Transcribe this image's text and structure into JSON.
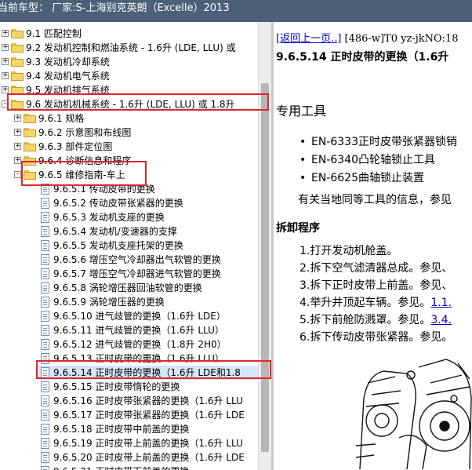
{
  "titlebar": {
    "text": "当前车型：  厂家:S-上海别克英朗（Excelle）2013"
  },
  "tree": {
    "rows": [
      {
        "label": "9.1 匹配控制",
        "indent": 0,
        "kind": "folder",
        "expander": "+"
      },
      {
        "label": "9.2 发动机控制和燃油系统 - 1.6升 (LDE, LLU) 或",
        "indent": 0,
        "kind": "folder",
        "expander": "+"
      },
      {
        "label": "9.3 发动机冷却系统",
        "indent": 0,
        "kind": "folder",
        "expander": "+"
      },
      {
        "label": "9.4 发动机电气系统",
        "indent": 0,
        "kind": "folder",
        "expander": "+"
      },
      {
        "label": "9.5 发动机排气系统",
        "indent": 0,
        "kind": "folder",
        "expander": "+"
      },
      {
        "label": "9.6 发动机机械系统 - 1.6升 (LDE, LLU) 或 1.8升",
        "indent": 0,
        "kind": "folder",
        "expander": "-"
      },
      {
        "label": "9.6.1 规格",
        "indent": 1,
        "kind": "folder",
        "expander": "+"
      },
      {
        "label": "9.6.2 示意图和布线图",
        "indent": 1,
        "kind": "folder",
        "expander": "+"
      },
      {
        "label": "9.6.3 部件定位图",
        "indent": 1,
        "kind": "folder",
        "expander": "+"
      },
      {
        "label": "9.6.4 诊断信息和程序",
        "indent": 1,
        "kind": "folder",
        "expander": "+"
      },
      {
        "label": "9.6.5 维修指南-车上",
        "indent": 1,
        "kind": "folder",
        "expander": "-"
      },
      {
        "label": "9.6.5.1 传动皮带的更换",
        "indent": 2,
        "kind": "doc"
      },
      {
        "label": "9.6.5.2 传动皮带张紧器的更换",
        "indent": 2,
        "kind": "doc"
      },
      {
        "label": "9.6.5.3 发动机支座的更换",
        "indent": 2,
        "kind": "doc"
      },
      {
        "label": "9.6.5.4 发动机/变速器的支撑",
        "indent": 2,
        "kind": "doc"
      },
      {
        "label": "9.6.5.5 发动机支座托架的更换",
        "indent": 2,
        "kind": "doc"
      },
      {
        "label": "9.6.5.6 增压空气冷却器出气软管的更换",
        "indent": 2,
        "kind": "doc"
      },
      {
        "label": "9.6.5.7 增压空气冷却器进气软管的更换",
        "indent": 2,
        "kind": "doc"
      },
      {
        "label": "9.6.5.8 涡轮增压器回油软管的更换",
        "indent": 2,
        "kind": "doc"
      },
      {
        "label": "9.6.5.9 涡轮增压器的更换",
        "indent": 2,
        "kind": "doc"
      },
      {
        "label": "9.6.5.10 进气歧管的更换（1.6升 LDE）",
        "indent": 2,
        "kind": "doc"
      },
      {
        "label": "9.6.5.11 进气歧管的更换（1.6升 LLU）",
        "indent": 2,
        "kind": "doc"
      },
      {
        "label": "9.6.5.12 进气歧管的更换（1.8升 2H0）",
        "indent": 2,
        "kind": "doc"
      },
      {
        "label": "9.6.5.13 正时皮带的更换（1.6升 LLU）",
        "indent": 2,
        "kind": "doc"
      },
      {
        "label": "9.6.5.14 正时皮带的更换（1.6升 LDE和1.8",
        "indent": 2,
        "kind": "doc",
        "selected": true
      },
      {
        "label": "9.6.5.15 正时皮带惰轮的更换",
        "indent": 2,
        "kind": "doc"
      },
      {
        "label": "9.6.5.16 正时皮带张紧器的更换（1.6升 LLU",
        "indent": 2,
        "kind": "doc"
      },
      {
        "label": "9.6.5.17 正时皮带张紧器的更换（1.6升 LDE",
        "indent": 2,
        "kind": "doc"
      },
      {
        "label": "9.6.5.18 正时皮带中前盖的更换",
        "indent": 2,
        "kind": "doc"
      },
      {
        "label": "9.6.5.19 正时皮带上前盖的更换（1.6升 LLU",
        "indent": 2,
        "kind": "doc"
      },
      {
        "label": "9.6.5.20 正时皮带上前盖的更换（1.6升 LDE",
        "indent": 2,
        "kind": "doc"
      },
      {
        "label": "9.6.5.21 正时皮带下前盖的更换",
        "indent": 2,
        "kind": "doc"
      }
    ]
  },
  "content": {
    "nav_link": "[返回上一页..]",
    "nav_rest": " [486-w]T0 yz-jkNO:18",
    "title": "9.6.5.14 正时皮带的更换（1.6升",
    "tools_heading": "专用工具",
    "tools": [
      "EN-6333正时皮带张紧器锁销",
      "EN-6340凸轮轴锁止工具",
      "EN-6625曲轴锁止装置"
    ],
    "tools_note": "有关当地同等工具的信息，参见",
    "removal_heading": "拆卸程序",
    "steps": [
      {
        "text": "1.打开发动机舱盖。",
        "link": ""
      },
      {
        "text": "2.拆下空气滤清器总成。参见、",
        "link": ""
      },
      {
        "text": "3.拆下正时皮带上前盖。参见、",
        "link": ""
      },
      {
        "text": "4.举升并顶起车辆。参见。",
        "link": "1.1."
      },
      {
        "text": "5.拆下前舱防溅罩。参见。",
        "link": "3.4."
      },
      {
        "text": "6.拆下传动皮带张紧器。参见。",
        "link": ""
      }
    ]
  },
  "colors": {
    "titlebar": "#4d5f79",
    "highlight": "#e0252b",
    "link": "#0000cc"
  }
}
